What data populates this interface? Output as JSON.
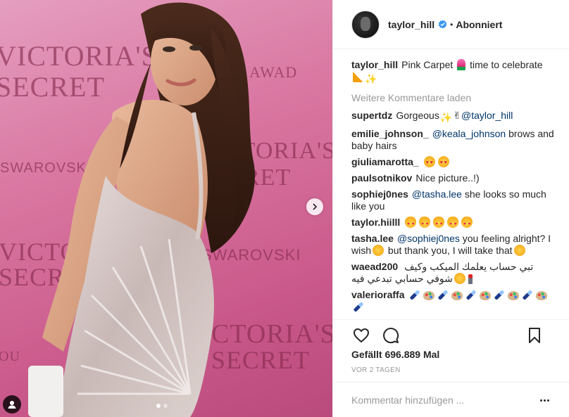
{
  "photo": {
    "bg_texts": [
      "VICTORIA'S",
      "SECRET",
      "AWAD",
      "CTORIA'S",
      "RET",
      "SWAROVSKI",
      "VICTORIA",
      "SECRET",
      "SWAROVSKI",
      "CTORIA'S",
      "SECRET",
      "OU"
    ],
    "slide_count": 2,
    "active_slide": 1
  },
  "header": {
    "username": "taylor_hill",
    "separator": "•",
    "follow_state": "Abonniert"
  },
  "caption": {
    "author": "taylor_hill",
    "text_a": "Pink Carpet",
    "text_b": "time to celebrate"
  },
  "load_more": "Weitere Kommentare laden",
  "comments": [
    {
      "author": "supertdz",
      "text": "Gorgeous",
      "mention": "@taylor_hill"
    },
    {
      "author": "emilie_johnson_",
      "mention": "@keala_johnson",
      "text": "brows and baby hairs"
    },
    {
      "author": "giuliamarotta_"
    },
    {
      "author": "paulsotnikov",
      "text": "Nice picture..!)"
    },
    {
      "author": "sophiej0nes",
      "mention": "@tasha.lee",
      "text": "she looks so much like you"
    },
    {
      "author": "taylor.hiilll"
    },
    {
      "author": "tasha.lee",
      "mention": "@sophiej0nes",
      "text_a": "you feeling alright? I wish",
      "text_b": "but thank you, I will take that"
    },
    {
      "author": "waead200",
      "text_a": "تبي حساب يعلمك الميكب وكيف تبدعي فيه",
      "text_b": "شوفي حسابي"
    },
    {
      "author": "valerioraffa"
    }
  ],
  "likes": "Gefällt 696.889 Mal",
  "timestamp": "VOR 2 TAGEN",
  "add_comment": {
    "placeholder": "Kommentar hinzufügen ..."
  },
  "icons": [
    "verified-badge-icon",
    "chevron-right-icon",
    "user-tag-icon",
    "heart-icon",
    "comment-icon",
    "bookmark-icon",
    "more-options-icon"
  ],
  "colors": {
    "verified": "#3897f0",
    "mention": "#003569",
    "muted": "#999999",
    "text": "#262626",
    "backdrop_pink": "#d8749f"
  }
}
